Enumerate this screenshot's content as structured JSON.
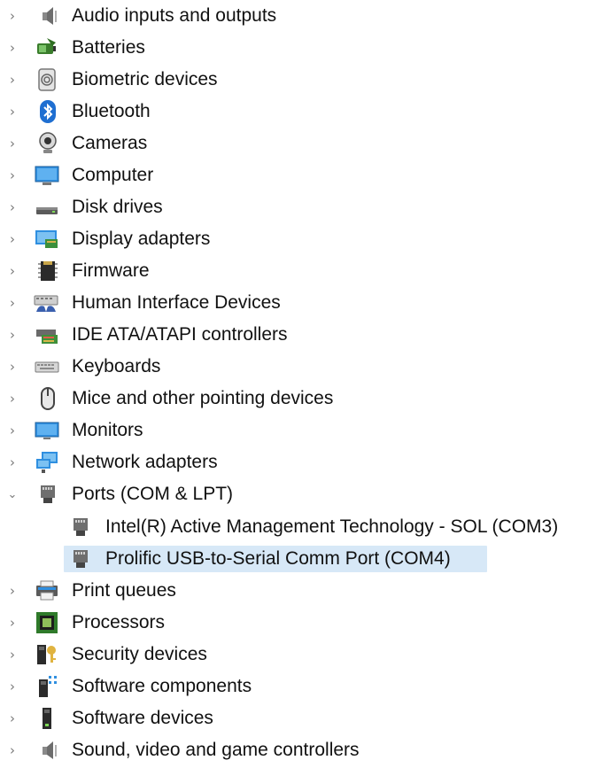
{
  "tree": {
    "partial_header": "Security devices",
    "items": [
      {
        "label": "Audio inputs and outputs",
        "icon": "speaker-icon",
        "expanded": false
      },
      {
        "label": "Batteries",
        "icon": "battery-icon",
        "expanded": false
      },
      {
        "label": "Biometric devices",
        "icon": "fingerprint-icon",
        "expanded": false
      },
      {
        "label": "Bluetooth",
        "icon": "bluetooth-icon",
        "expanded": false
      },
      {
        "label": "Cameras",
        "icon": "webcam-icon",
        "expanded": false
      },
      {
        "label": "Computer",
        "icon": "monitor-icon",
        "expanded": false
      },
      {
        "label": "Disk drives",
        "icon": "disk-drive-icon",
        "expanded": false
      },
      {
        "label": "Display adapters",
        "icon": "display-adapter-icon",
        "expanded": false
      },
      {
        "label": "Firmware",
        "icon": "chip-icon",
        "expanded": false
      },
      {
        "label": "Human Interface Devices",
        "icon": "hid-icon",
        "expanded": false
      },
      {
        "label": "IDE ATA/ATAPI controllers",
        "icon": "ide-controller-icon",
        "expanded": false
      },
      {
        "label": "Keyboards",
        "icon": "keyboard-icon",
        "expanded": false
      },
      {
        "label": "Mice and other pointing devices",
        "icon": "mouse-icon",
        "expanded": false
      },
      {
        "label": "Monitors",
        "icon": "monitor-icon",
        "expanded": false
      },
      {
        "label": "Network adapters",
        "icon": "network-adapter-icon",
        "expanded": false
      },
      {
        "label": "Ports (COM & LPT)",
        "icon": "port-icon",
        "expanded": true,
        "children": [
          {
            "label": "Intel(R) Active Management Technology - SOL (COM3)",
            "icon": "port-icon",
            "selected": false
          },
          {
            "label": "Prolific USB-to-Serial Comm Port (COM4)",
            "icon": "port-icon",
            "selected": true
          }
        ]
      },
      {
        "label": "Print queues",
        "icon": "printer-icon",
        "expanded": false
      },
      {
        "label": "Processors",
        "icon": "processor-icon",
        "expanded": false
      },
      {
        "label": "Security devices",
        "icon": "security-key-icon",
        "expanded": false
      },
      {
        "label": "Software components",
        "icon": "software-component-icon",
        "expanded": false
      },
      {
        "label": "Software devices",
        "icon": "software-device-icon",
        "expanded": false
      },
      {
        "label": "Sound, video and game controllers",
        "icon": "speaker-icon",
        "expanded": false
      }
    ]
  },
  "colors": {
    "selection": "#d7e8f7",
    "chevron": "#7a7a7a",
    "text": "#111111"
  }
}
